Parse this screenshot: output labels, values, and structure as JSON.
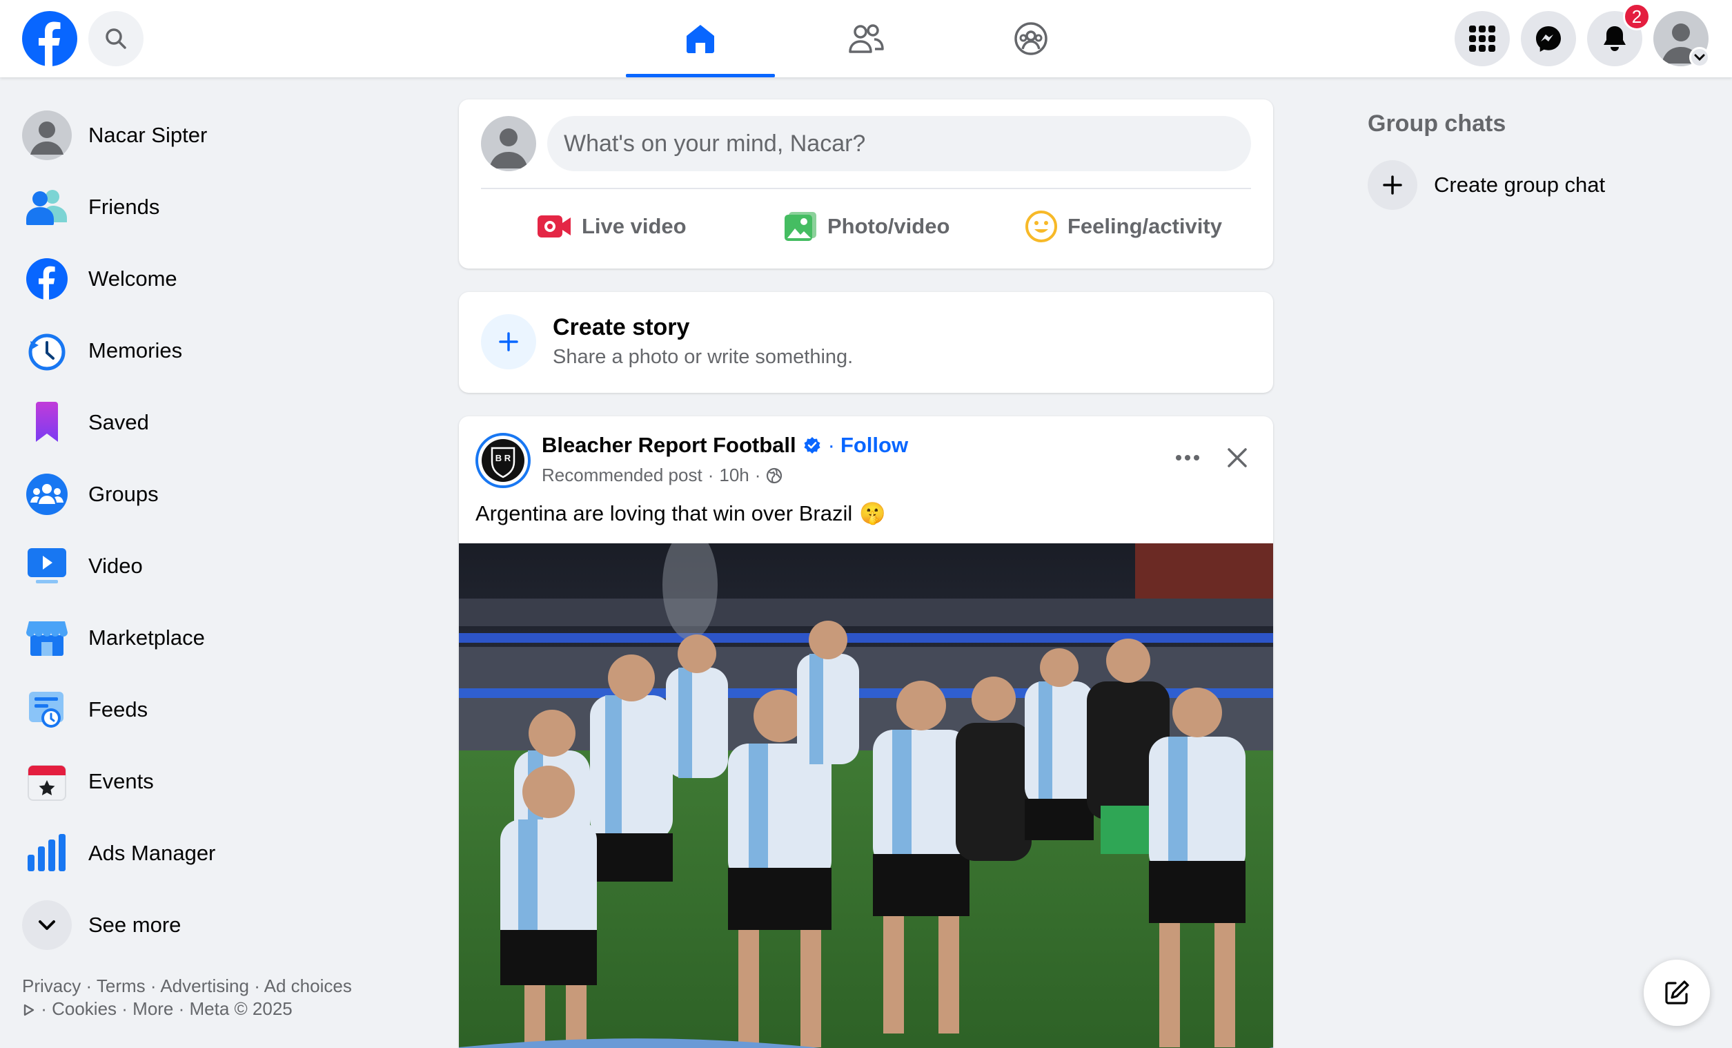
{
  "topbar": {
    "icons": [
      "facebook-logo",
      "search-icon",
      "home-icon",
      "friends-icon",
      "groups-icon",
      "menu-grid-icon",
      "messenger-icon",
      "bell-icon",
      "avatar"
    ],
    "notification_count": "2",
    "active_tab": "home"
  },
  "colors": {
    "accent": "#0866ff",
    "badge": "#e41e3f",
    "background": "#f0f2f5"
  },
  "sidebar": {
    "profile_name": "Nacar Sipter",
    "items": [
      {
        "label": "Friends",
        "icon": "friends-icon"
      },
      {
        "label": "Welcome",
        "icon": "facebook-icon"
      },
      {
        "label": "Memories",
        "icon": "memories-clock-icon"
      },
      {
        "label": "Saved",
        "icon": "bookmark-icon"
      },
      {
        "label": "Groups",
        "icon": "groups-icon"
      },
      {
        "label": "Video",
        "icon": "video-icon"
      },
      {
        "label": "Marketplace",
        "icon": "marketplace-store-icon"
      },
      {
        "label": "Feeds",
        "icon": "feeds-icon"
      },
      {
        "label": "Events",
        "icon": "events-calendar-icon"
      },
      {
        "label": "Ads Manager",
        "icon": "ads-chart-icon"
      }
    ],
    "see_more": "See more",
    "footer": {
      "privacy": "Privacy",
      "terms": "Terms",
      "advertising": "Advertising",
      "ad_choices": "Ad choices",
      "cookies": "Cookies",
      "more": "More",
      "meta": "Meta © 2025"
    }
  },
  "composer": {
    "placeholder": "What's on your mind, Nacar?",
    "actions": [
      "Live video",
      "Photo/video",
      "Feeling/activity"
    ]
  },
  "story": {
    "title": "Create story",
    "subtitle": "Share a photo or write something."
  },
  "post": {
    "author": "Bleacher Report Football",
    "follow": "Follow",
    "meta_label": "Recommended post",
    "time": "10h",
    "text": "Argentina are loving that win over Brazil",
    "emoji": "🤫",
    "avatar_text": "B R"
  },
  "right": {
    "group_chats_title": "Group chats",
    "create_group_chat": "Create group chat"
  }
}
